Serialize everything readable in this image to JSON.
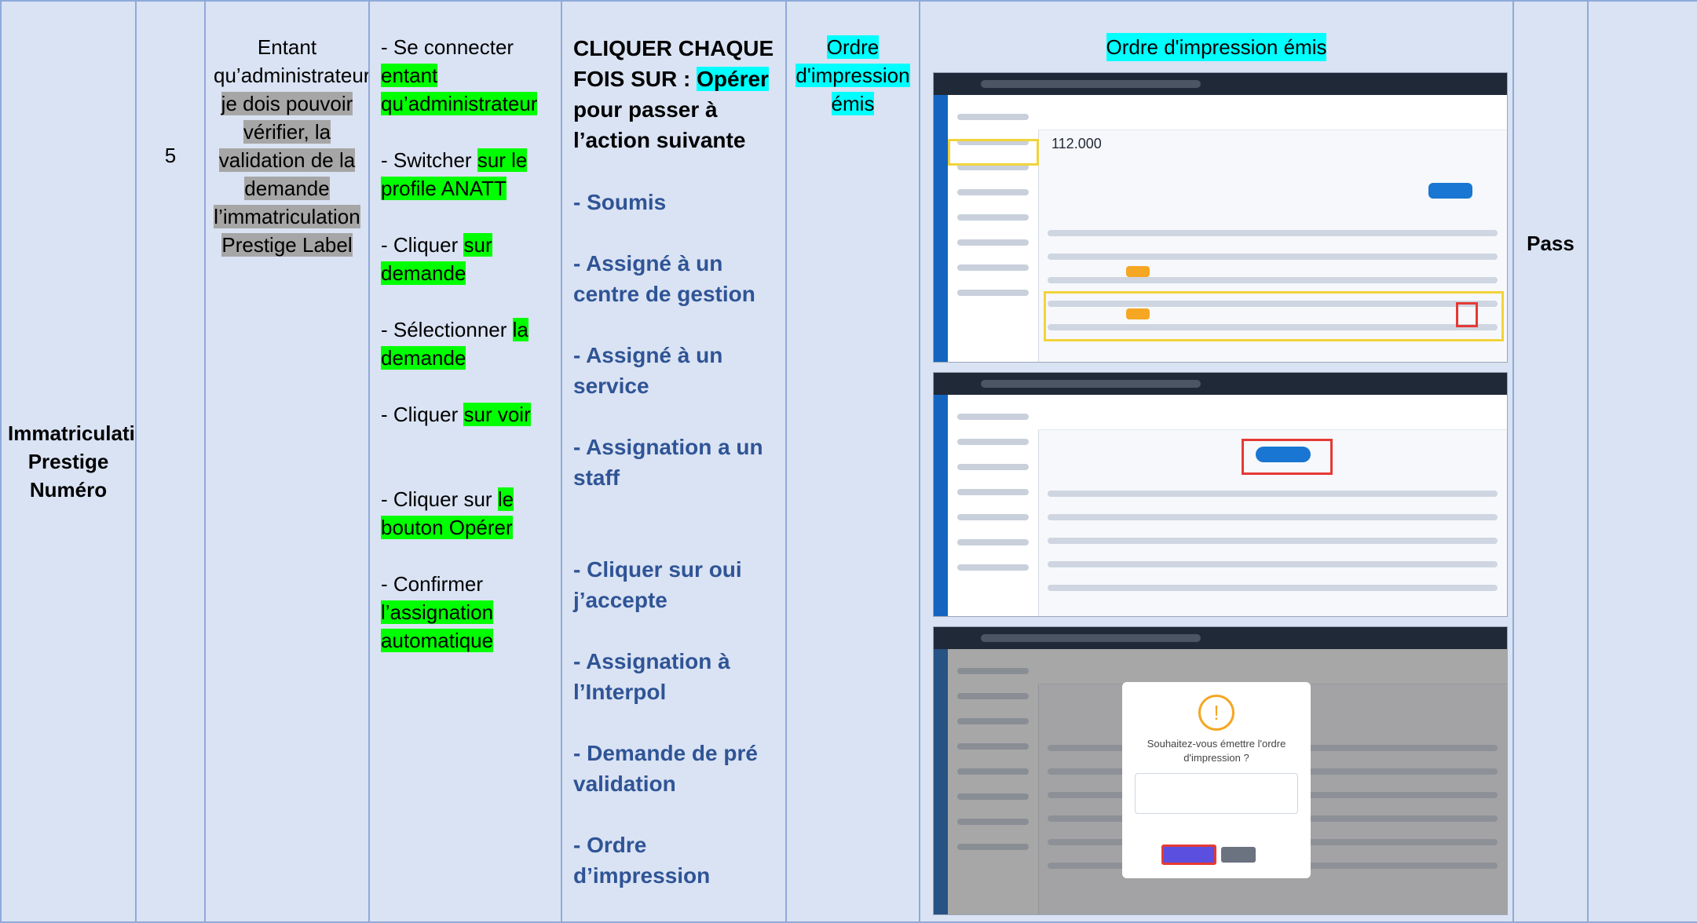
{
  "feature": "Immatriculation Prestige Numéro",
  "number": "5",
  "story": {
    "part1": "Entant qu’administrateur, ",
    "part2": "je dois pouvoir vérifier, la validation de la demande l’immatriculation Prestige Label"
  },
  "steps": [
    {
      "prefix": "- Se connecter ",
      "highlight": "entant qu’administrateur"
    },
    {
      "prefix": "- Switcher ",
      "highlight": "sur le profile ANATT"
    },
    {
      "prefix": "- Cliquer ",
      "highlight": "sur demande"
    },
    {
      "prefix": "- Sélectionner ",
      "highlight": "la demande"
    },
    {
      "prefix": "- Cliquer ",
      "highlight": "sur voir"
    },
    {
      "prefix": "- Cliquer sur ",
      "highlight": "le bouton Opérer"
    },
    {
      "prefix": "- Confirmer ",
      "highlight": "l’assignation automatique"
    }
  ],
  "expected": {
    "head_prefix": "CLIQUER CHAQUE FOIS SUR : ",
    "head_highlight": "Opérer",
    "head_suffix": " pour passer à l’action suivante",
    "items": [
      "- Soumis",
      "- Assigné à un centre de gestion",
      "- Assigné à un service",
      "- Assignation a un staff",
      "- Cliquer sur oui j’accepte",
      "- Assignation à l’Interpol",
      "- Demande de pré validation",
      "- Ordre d’impression"
    ]
  },
  "obtained": "Ordre d'impression émis",
  "evidence_caption": "Ordre d'impression émis",
  "status": "Pass",
  "screenshots": {
    "amount": "112.000",
    "modal_title": "Souhaitez-vous émettre l'ordre d'impression ?"
  },
  "colors": {
    "row_bg": "#dae3f3",
    "border": "#8eaadb",
    "grey_highlight": "#a6a6a6",
    "green_highlight": "#00ff00",
    "cyan_highlight": "#00ffff",
    "expected_text": "#2f5496",
    "pass": "#00b050"
  }
}
